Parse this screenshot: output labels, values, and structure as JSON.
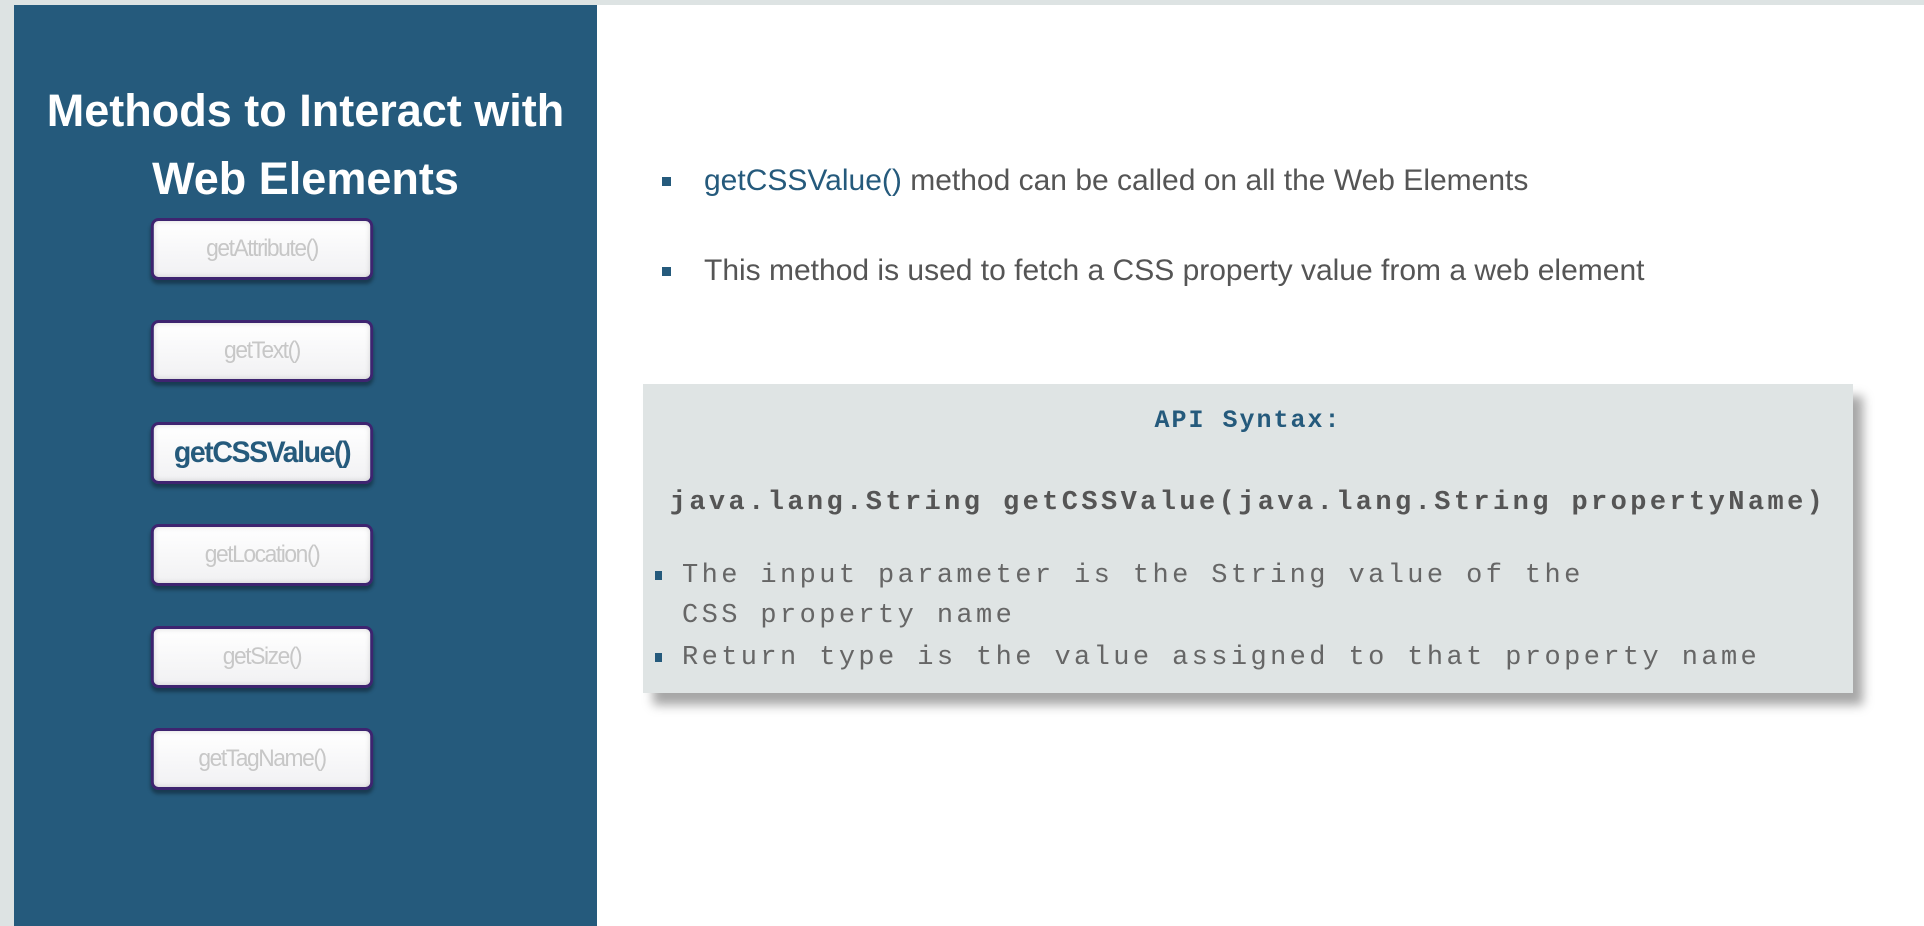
{
  "sidebar": {
    "title_line1": "Methods to Interact with",
    "title_line2": "Web Elements",
    "buttons": [
      {
        "label": "getAttribute()",
        "active": false
      },
      {
        "label": "getText()",
        "active": false
      },
      {
        "label": "getCSSValue()",
        "active": true
      },
      {
        "label": "getLocation()",
        "active": false
      },
      {
        "label": "getSize()",
        "active": false
      },
      {
        "label": "getTagName()",
        "active": false
      }
    ]
  },
  "main": {
    "bullet1_highlight": "getCSSValue()",
    "bullet1_rest": " method can be called on all the Web Elements",
    "bullet2": "This method is used to fetch a CSS property value from a web element",
    "box": {
      "heading": "API Syntax:",
      "signature": "java.lang.String getCSSValue(java.lang.String propertyName)",
      "points": [
        "The input parameter is the String value of the CSS property name",
        "Return type is the value assigned to that property name"
      ]
    }
  },
  "colors": {
    "accent": "#255a7c",
    "box_bg": "#dfe4e4",
    "button_border": "#3e2470"
  }
}
